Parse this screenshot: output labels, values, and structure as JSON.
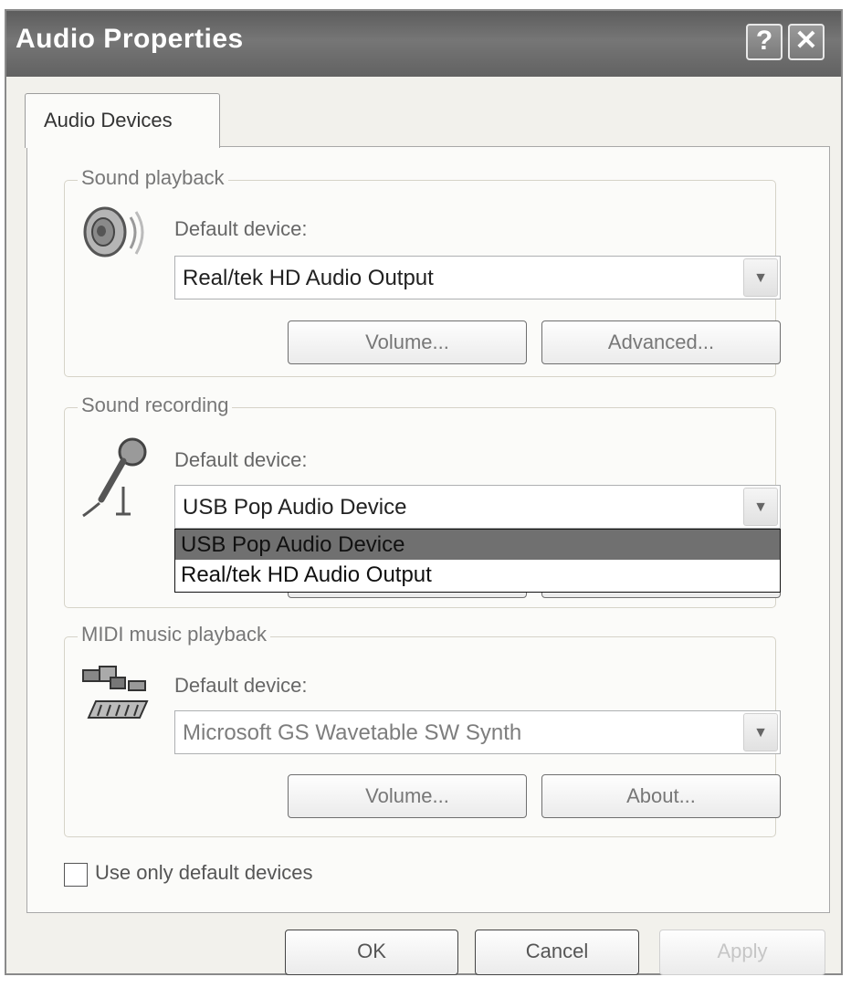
{
  "window": {
    "title": "Audio Properties",
    "help_glyph": "?",
    "close_glyph": "✕"
  },
  "tab": {
    "label": "Audio Devices"
  },
  "playback": {
    "group_title": "Sound playback",
    "icon": "speaker-icon",
    "default_device_label": "Default device:",
    "selected_device": "Real/tek HD Audio Output",
    "volume_button": "Volume...",
    "advanced_button": "Advanced..."
  },
  "recording": {
    "group_title": "Sound recording",
    "icon": "microphone-icon",
    "default_device_label": "Default device:",
    "selected_device": "USB Pop Audio Device",
    "dropdown_open": true,
    "options": [
      "USB Pop Audio Device",
      "Real/tek HD Audio Output"
    ],
    "highlighted_option": "USB Pop Audio Device"
  },
  "midi": {
    "group_title": "MIDI music playback",
    "icon": "midi-keyboard-icon",
    "default_device_label": "Default device:",
    "selected_device": "Microsoft GS Wavetable SW Synth",
    "volume_button": "Volume...",
    "about_button": "About..."
  },
  "options": {
    "use_default_only_label": "Use only default devices",
    "use_default_only_checked": false
  },
  "footer": {
    "ok": "OK",
    "cancel": "Cancel",
    "apply": "Apply"
  },
  "colors": {
    "titlebar": "#6a6a6a",
    "highlight": "#707070"
  }
}
